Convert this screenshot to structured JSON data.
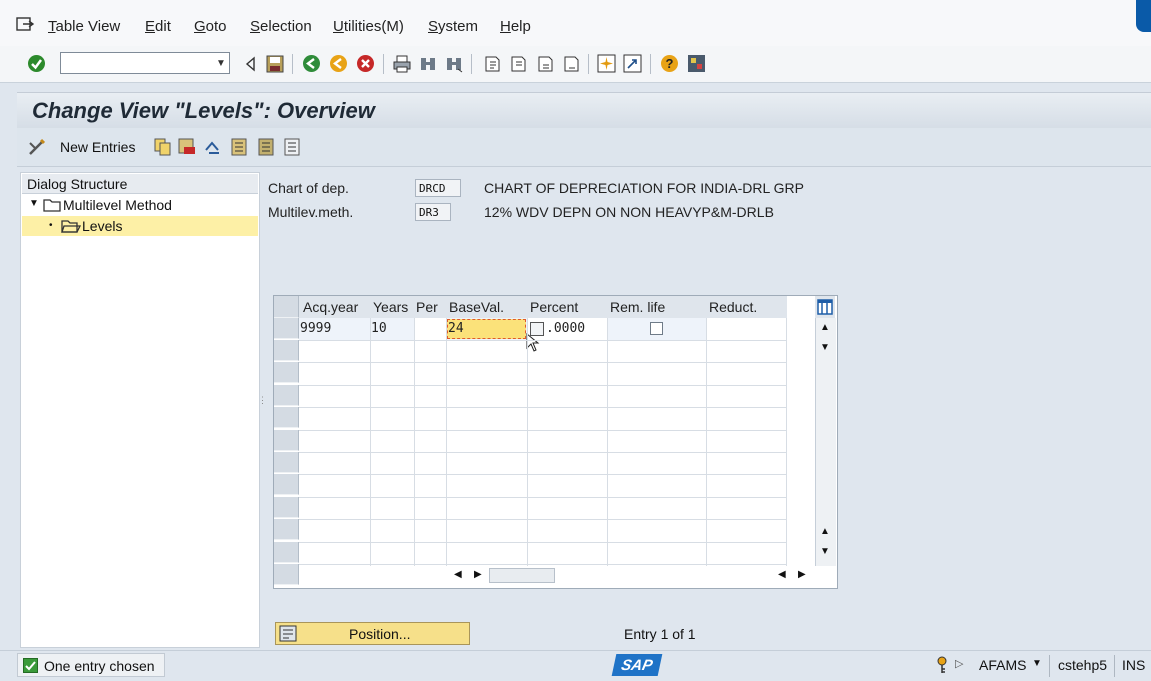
{
  "menu": {
    "items": [
      "Table View",
      "Edit",
      "Goto",
      "Selection",
      "Utilities(M)",
      "System",
      "Help"
    ]
  },
  "toolbar": {
    "command_value": "",
    "icons": [
      "enter-icon",
      "back-arrow-icon",
      "save-icon",
      "back-icon",
      "exit-icon",
      "cancel-icon",
      "print-icon",
      "find-icon",
      "find-next-icon",
      "first-page-icon",
      "previous-page-icon",
      "next-page-icon",
      "last-page-icon",
      "create-session-icon",
      "shortcut-icon",
      "help-icon",
      "customize-layout-icon"
    ]
  },
  "title": "Change View \"Levels\": Overview",
  "app_toolbar": {
    "new_entries": "New Entries"
  },
  "dialog_structure": {
    "heading": "Dialog Structure",
    "nodes": [
      {
        "label": "Multilevel Method",
        "expanded": true
      },
      {
        "label": "Levels",
        "selected": true
      }
    ]
  },
  "header_fields": [
    {
      "label": "Chart of dep.",
      "value": "DRCD",
      "description": "CHART OF DEPRECIATION FOR INDIA-DRL GRP"
    },
    {
      "label": "Multilev.meth.",
      "value": "DR3",
      "description": "12% WDV DEPN ON NON HEAVYP&M-DRLB"
    }
  ],
  "table": {
    "columns": [
      "Acq.year",
      "Years",
      "Per",
      "BaseVal.",
      "Percent",
      "Rem. life",
      "Reduct."
    ],
    "rows": [
      {
        "acq_year": "9999",
        "years": "10",
        "per": "",
        "baseval": "24",
        "percent": ".0000",
        "rem_life_checked": false,
        "reduct": ""
      }
    ],
    "empty_rows": 11
  },
  "position_button": "Position...",
  "entry_info": "Entry 1 of 1",
  "status": {
    "message": "One entry chosen",
    "system": "AFAMS",
    "server": "cstehp5",
    "mode": "INS",
    "logo": "SAP"
  }
}
